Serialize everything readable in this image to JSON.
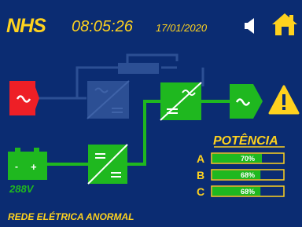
{
  "header": {
    "logo": "NHS",
    "time": "08:05:26",
    "date": "17/01/2020",
    "sound_icon": "speaker-icon",
    "home_icon": "home-icon"
  },
  "battery": {
    "voltage": "288V",
    "minus": "-",
    "plus": "+"
  },
  "power": {
    "title": "POTÊNCIA",
    "phases": [
      {
        "label": "A",
        "value_text": "70%",
        "value": 70
      },
      {
        "label": "B",
        "value_text": "68%",
        "value": 68
      },
      {
        "label": "C",
        "value_text": "68%",
        "value": 68
      }
    ]
  },
  "status": {
    "message": "REDE ELÉTRICA ANORMAL",
    "warning_icon": "warning-icon"
  },
  "colors": {
    "background": "#0b2c72",
    "accent": "#ffd21e",
    "active": "#1fb81f",
    "alarm": "#ee1f26",
    "inactive": "#2c4f94"
  }
}
